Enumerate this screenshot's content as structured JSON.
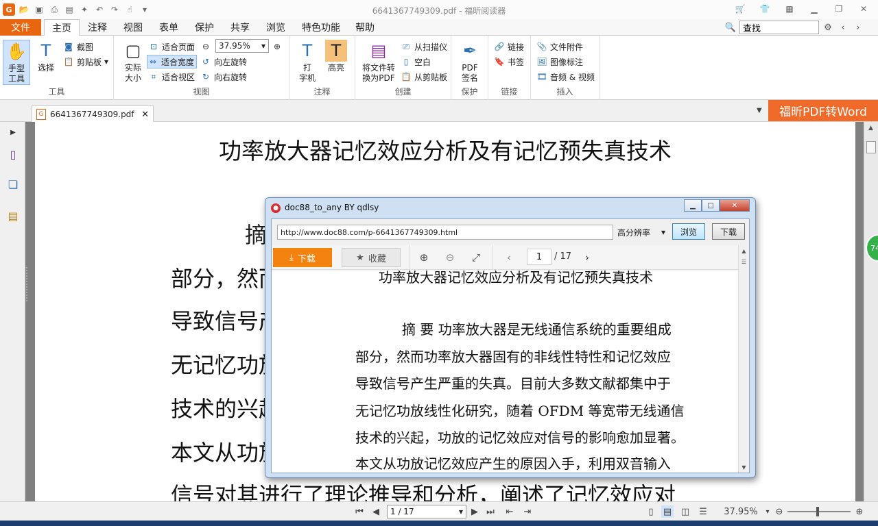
{
  "titlebar": {
    "title": "6641367749309.pdf - 福昕阅读器",
    "logo": "G"
  },
  "menu": {
    "file": "文件",
    "tabs": [
      "主页",
      "注释",
      "视图",
      "表单",
      "保护",
      "共享",
      "浏览",
      "特色功能",
      "帮助"
    ],
    "search_value": "查找"
  },
  "ribbon": {
    "tools": {
      "hand": "手型\n工具",
      "select": "选择",
      "screenshot": "截图",
      "clipboard": "剪贴板",
      "label": "工具"
    },
    "view": {
      "actual_size": "实际\n大小",
      "fit_page": "适合页面",
      "fit_width": "适合宽度",
      "fit_visible": "适合视区",
      "zoom": "37.95%",
      "rotate_left": "向左旋转",
      "rotate_right": "向右旋转",
      "label": "视图"
    },
    "annot": {
      "typewriter": "打\n字机",
      "highlight": "高亮",
      "label": "注释"
    },
    "create": {
      "convert": "将文件转\n换为PDF",
      "scanner": "从扫描仪",
      "blank": "空白",
      "from_clipboard": "从剪贴板",
      "label": "创建"
    },
    "protect": {
      "sign": "PDF\n签名",
      "label": "保护"
    },
    "link": {
      "link": "链接",
      "bookmark": "书签",
      "label": "链接"
    },
    "insert": {
      "attachment": "文件附件",
      "image": "图像标注",
      "av": "音频 & 视频",
      "label": "插入"
    }
  },
  "doc_tab": {
    "name": "6641367749309.pdf",
    "promo": "福昕PDF转Word"
  },
  "page": {
    "title": "功率放大器记忆效应分析及有记忆预失真技术",
    "abstract_head": "摘",
    "lines": [
      "部分，然而",
      "导致信号产",
      "无记忆功放",
      "技术的兴起",
      "本文从功放",
      "信号对其进行了理论推导和分析，阐述了记忆效应对"
    ]
  },
  "status": {
    "page": "1 / 17",
    "zoom": "37.95%"
  },
  "badge": "74",
  "popup": {
    "title": "doc88_to_any BY qdlsy",
    "url": "http://www.doc88.com/p-6641367749309.html",
    "resolution": "高分辨率",
    "browse": "浏览",
    "download": "下载",
    "dl_orange": "下载",
    "favorite": "收藏",
    "page_num": "1",
    "page_total": "/ 17",
    "viewer_title": "功率放大器记忆效应分析及有记忆预失真技术",
    "viewer_lines": [
      "摘  要  功率放大器是无线通信系统的重要组成",
      "部分，然而功率放大器固有的非线性特性和记忆效应",
      "导致信号产生严重的失真。目前大多数文献都集中于",
      "无记忆功放线性化研究，随着 OFDM 等宽带无线通信",
      "技术的兴起，功放的记忆效应对信号的影响愈加显著。",
      "本文从功放记忆效应产生的原因入手，利用双音输入"
    ]
  }
}
